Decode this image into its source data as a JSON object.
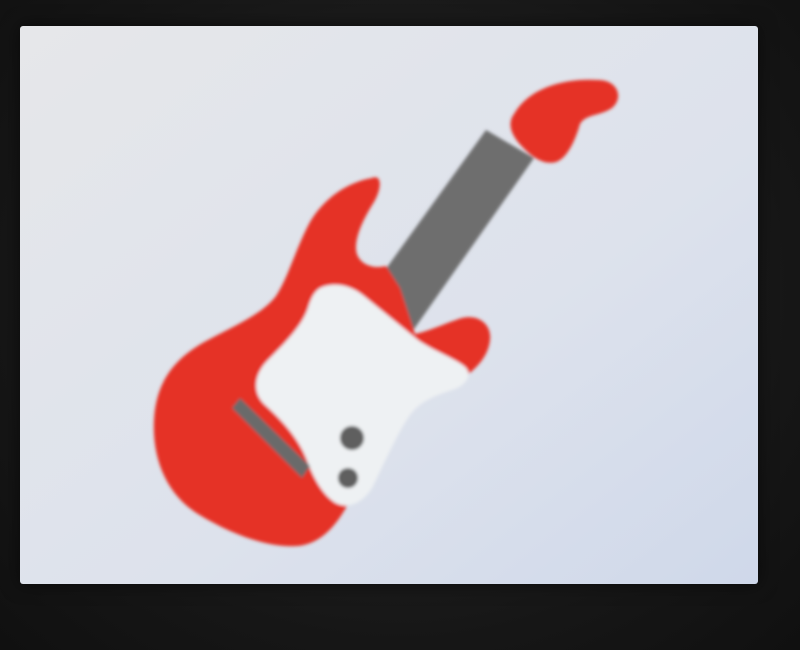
{
  "scene": {
    "subject_icon": "electric-guitar-icon",
    "colors": {
      "surround": "#171717",
      "screen_background": "#dfe3ec",
      "guitar_body": "#e53327",
      "pickguard": "#eef1f3",
      "neck": "#6e6e6e",
      "headstock": "#e53327",
      "pickup": "#6a6a6a",
      "knobs": "#5f5f5f"
    }
  }
}
